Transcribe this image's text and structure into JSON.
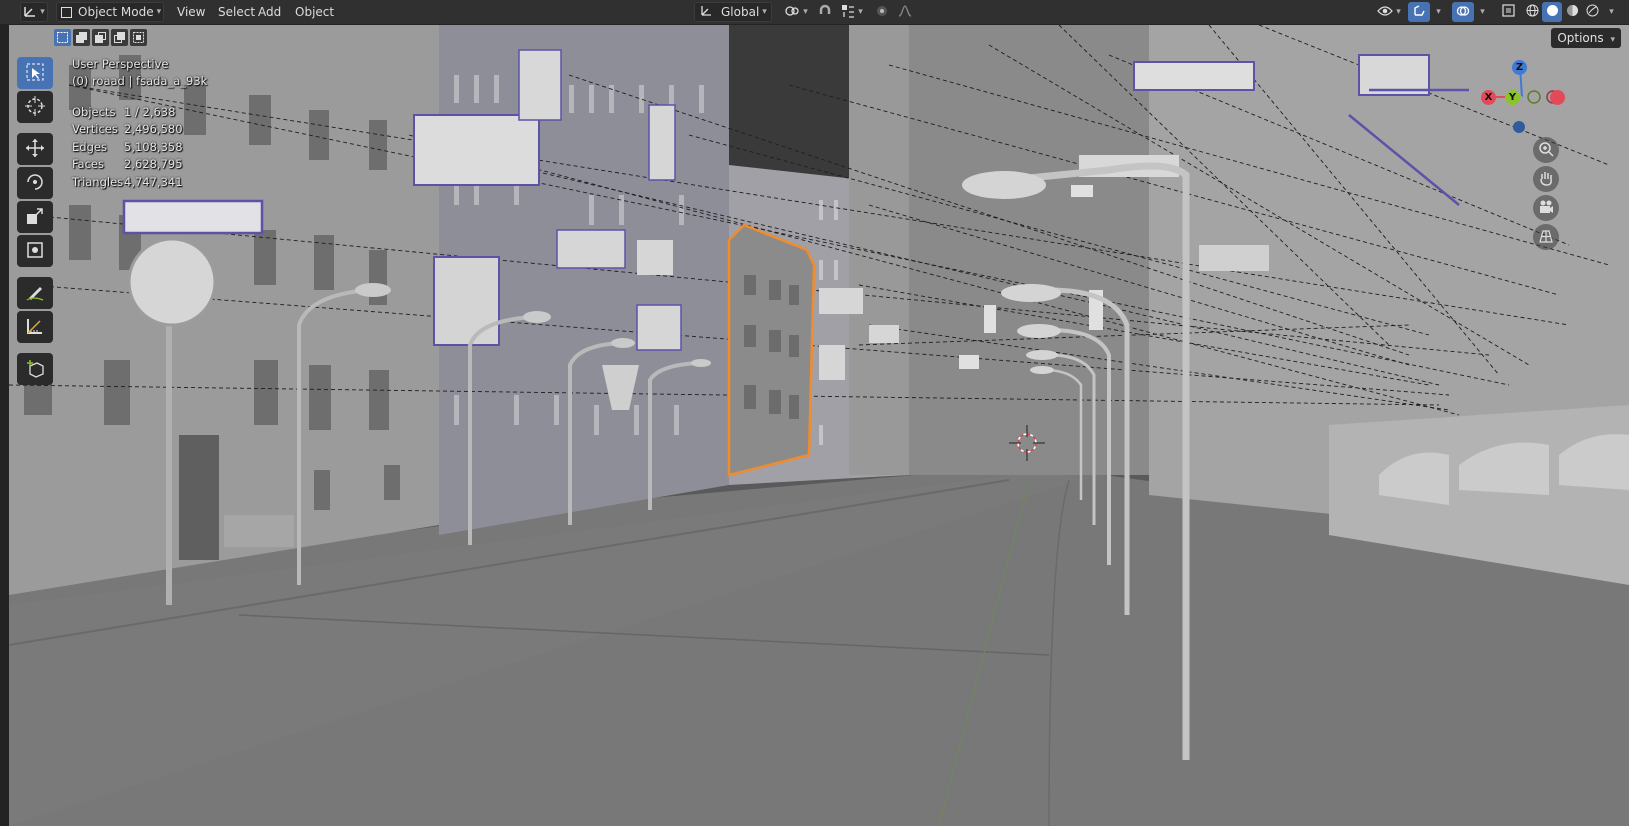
{
  "header": {
    "editor_type_icon": "axes-icon",
    "mode": "Object Mode",
    "menus": [
      "View",
      "Select",
      "Add",
      "Object"
    ],
    "orientation": "Global",
    "icons": {
      "transform_pivot": "pivot-icon",
      "snap": "magnet-icon",
      "snap_target": "snap-target-icon",
      "proportional": "proportional-edit-icon",
      "falloff": "falloff-curve-icon",
      "visibility": "eye-icon",
      "gizmo": "gizmo-icon",
      "overlays": "overlays-icon",
      "xray": "xray-icon",
      "shading_wire": "wireframe-shading-icon",
      "shading_solid": "solid-shading-icon",
      "shading_material": "material-shading-icon",
      "shading_rendered": "rendered-shading-icon"
    }
  },
  "viewport": {
    "title": "User Perspective",
    "subtitle": "(0) roaad | fsada_a_93k",
    "options_label": "Options",
    "stats": [
      {
        "label": "Objects",
        "value": "1 / 2,638"
      },
      {
        "label": "Vertices",
        "value": "2,496,580"
      },
      {
        "label": "Edges",
        "value": "5,108,358"
      },
      {
        "label": "Faces",
        "value": "2,628,795"
      },
      {
        "label": "Triangles",
        "value": "4,747,341"
      }
    ],
    "select_modes": [
      "select-new-icon",
      "select-extend-icon",
      "select-subtract-icon",
      "select-difference-icon",
      "select-intersect-icon"
    ],
    "tools": [
      "select-box-icon",
      "cursor-icon",
      "move-icon",
      "rotate-icon",
      "scale-icon",
      "transform-icon",
      "annotate-icon",
      "measure-icon",
      "add-cube-icon"
    ],
    "nav_gizmo": {
      "x": "X",
      "y": "Y",
      "z": "Z"
    },
    "nav_buttons": [
      "zoom-icon",
      "hand-pan-icon",
      "camera-icon",
      "grid-ortho-icon"
    ]
  },
  "colors": {
    "header_bg": "#303030",
    "accent": "#4772b3",
    "selection": "#f08c2c",
    "axis_x": "#e24a5a",
    "axis_y": "#8bc32a",
    "axis_z": "#3f7ad6"
  }
}
